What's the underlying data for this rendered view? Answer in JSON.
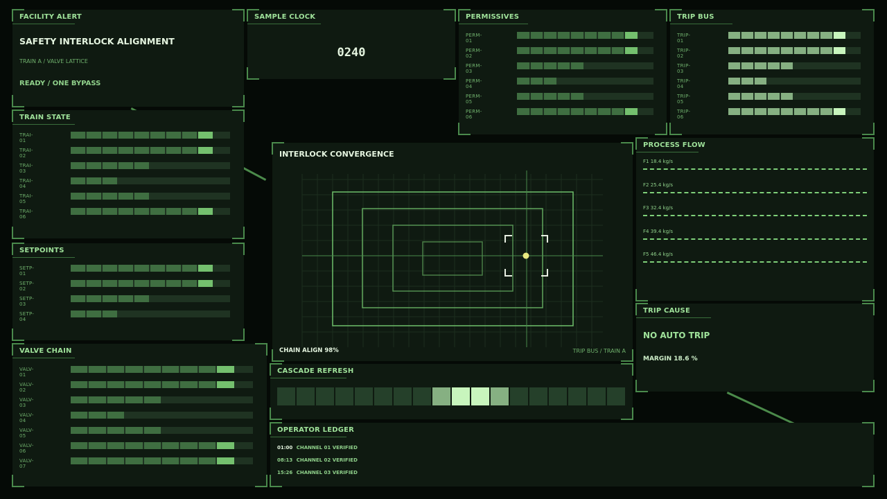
{
  "facility_alert": {
    "title": "FACILITY ALERT",
    "headline": "SAFETY INTERLOCK ALIGNMENT",
    "subline": "TRAIN A / VALVE LATTICE",
    "status": "READY / ONE BYPASS"
  },
  "sample_clock": {
    "title": "SAMPLE CLOCK",
    "value": "0240"
  },
  "permissives": {
    "title": "PERMISSIVES",
    "rows": [
      {
        "label": "PERM-01",
        "level": 0.9
      },
      {
        "label": "PERM-02",
        "level": 0.9
      },
      {
        "label": "PERM-03",
        "level": 0.5
      },
      {
        "label": "PERM-04",
        "level": 0.3
      },
      {
        "label": "PERM-05",
        "level": 0.5
      },
      {
        "label": "PERM-06",
        "level": 0.9
      }
    ]
  },
  "trip_bus": {
    "title": "TRIP BUS",
    "rows": [
      {
        "label": "TRIP-01",
        "level": 0.9
      },
      {
        "label": "TRIP-02",
        "level": 0.9
      },
      {
        "label": "TRIP-03",
        "level": 0.5
      },
      {
        "label": "TRIP-04",
        "level": 0.3
      },
      {
        "label": "TRIP-05",
        "level": 0.5
      },
      {
        "label": "TRIP-06",
        "level": 0.9
      }
    ]
  },
  "train_state": {
    "title": "TRAIN STATE",
    "rows": [
      {
        "label": "TRAI-01",
        "level": 0.9
      },
      {
        "label": "TRAI-02",
        "level": 0.9
      },
      {
        "label": "TRAI-03",
        "level": 0.5
      },
      {
        "label": "TRAI-04",
        "level": 0.3
      },
      {
        "label": "TRAI-05",
        "level": 0.5
      },
      {
        "label": "TRAI-06",
        "level": 0.9
      }
    ]
  },
  "setpoints": {
    "title": "SETPOINTS",
    "rows": [
      {
        "label": "SETP-01",
        "level": 0.9
      },
      {
        "label": "SETP-02",
        "level": 0.9
      },
      {
        "label": "SETP-03",
        "level": 0.5
      },
      {
        "label": "SETP-04",
        "level": 0.3
      }
    ]
  },
  "valve_chain": {
    "title": "VALVE CHAIN",
    "rows": [
      {
        "label": "VALV-01",
        "level": 0.9
      },
      {
        "label": "VALV-02",
        "level": 0.9
      },
      {
        "label": "VALV-03",
        "level": 0.5
      },
      {
        "label": "VALV-04",
        "level": 0.3
      },
      {
        "label": "VALV-05",
        "level": 0.5
      },
      {
        "label": "VALV-06",
        "level": 0.9
      },
      {
        "label": "VALV-07",
        "level": 0.9
      }
    ]
  },
  "convergence": {
    "title": "INTERLOCK CONVERGENCE",
    "chain_align": "CHAIN ALIGN 98%",
    "route": "TRIP BUS / TRAIN A"
  },
  "process_flow": {
    "title": "PROCESS FLOW",
    "rows": [
      {
        "label": "F1  18.4 kg/s"
      },
      {
        "label": "F2  25.4 kg/s"
      },
      {
        "label": "F3  32.4 kg/s"
      },
      {
        "label": "F4  39.4 kg/s"
      },
      {
        "label": "F5  46.4 kg/s"
      }
    ]
  },
  "trip_cause": {
    "title": "TRIP CAUSE",
    "headline": "NO AUTO TRIP",
    "margin": "MARGIN  18.6 %"
  },
  "cascade_refresh": {
    "title": "CASCADE REFRESH",
    "cells": [
      0,
      0,
      0,
      0,
      0,
      0,
      0,
      0,
      1,
      2,
      2,
      1,
      0,
      0,
      0,
      0,
      0,
      0
    ]
  },
  "operator_ledger": {
    "title": "OPERATOR LEDGER",
    "entries": [
      {
        "time": "01:00",
        "text": "CHANNEL 01 VERIFIED"
      },
      {
        "time": "08:13",
        "text": "CHANNEL 02 VERIFIED"
      },
      {
        "time": "15:26",
        "text": "CHANNEL 03 VERIFIED"
      }
    ]
  },
  "colors": {
    "accent": "#9fe29a",
    "panel": "#0f1a11",
    "background": "#050a06",
    "target": "#e8e880"
  }
}
